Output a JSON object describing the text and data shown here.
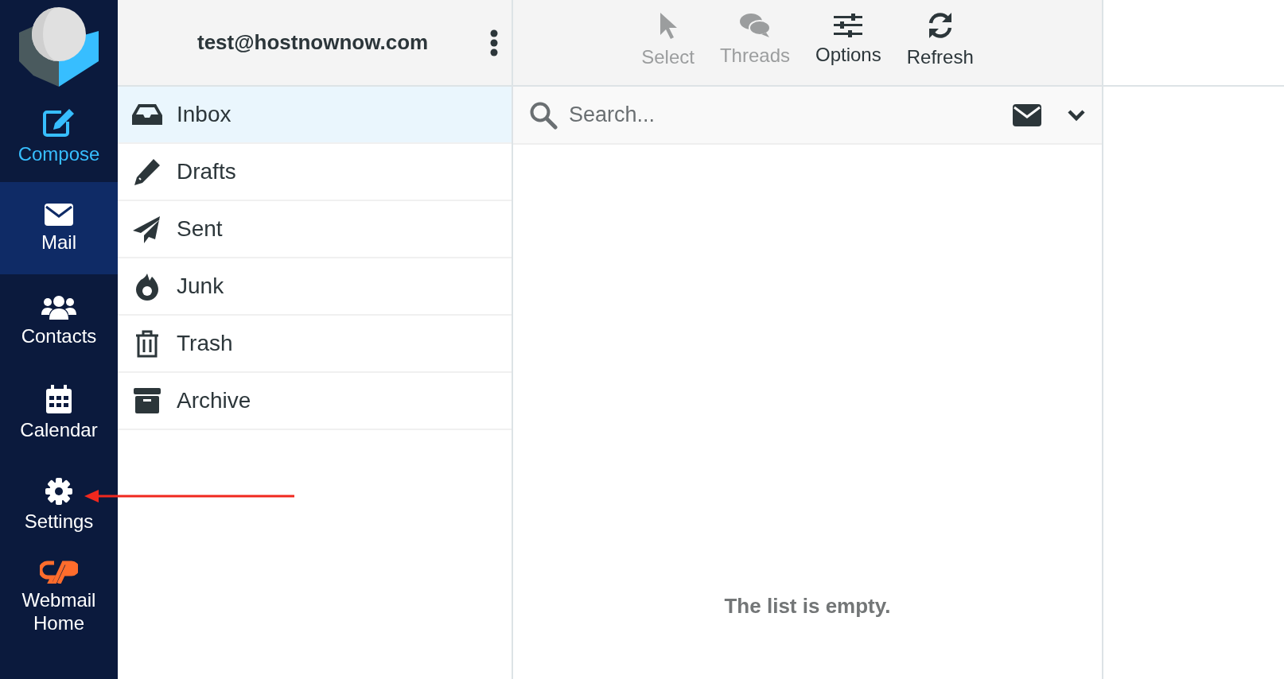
{
  "sidebar": {
    "items": [
      {
        "label": "Compose",
        "kind": "action",
        "selected": false
      },
      {
        "label": "Mail",
        "kind": "nav",
        "selected": true
      },
      {
        "label": "Contacts",
        "kind": "nav",
        "selected": false
      },
      {
        "label": "Calendar",
        "kind": "nav",
        "selected": false
      },
      {
        "label": "Settings",
        "kind": "nav",
        "selected": false
      },
      {
        "label": "Webmail Home",
        "kind": "nav",
        "selected": false
      }
    ]
  },
  "account": {
    "email": "test@hostnownow.com"
  },
  "folders": [
    {
      "label": "Inbox",
      "selected": true
    },
    {
      "label": "Drafts",
      "selected": false
    },
    {
      "label": "Sent",
      "selected": false
    },
    {
      "label": "Junk",
      "selected": false
    },
    {
      "label": "Trash",
      "selected": false
    },
    {
      "label": "Archive",
      "selected": false
    }
  ],
  "toolbar": [
    {
      "label": "Select",
      "disabled": true
    },
    {
      "label": "Threads",
      "disabled": true
    },
    {
      "label": "Options",
      "disabled": false
    },
    {
      "label": "Refresh",
      "disabled": false
    }
  ],
  "search": {
    "placeholder": "Search..."
  },
  "message_list": {
    "empty_text": "The list is empty."
  }
}
